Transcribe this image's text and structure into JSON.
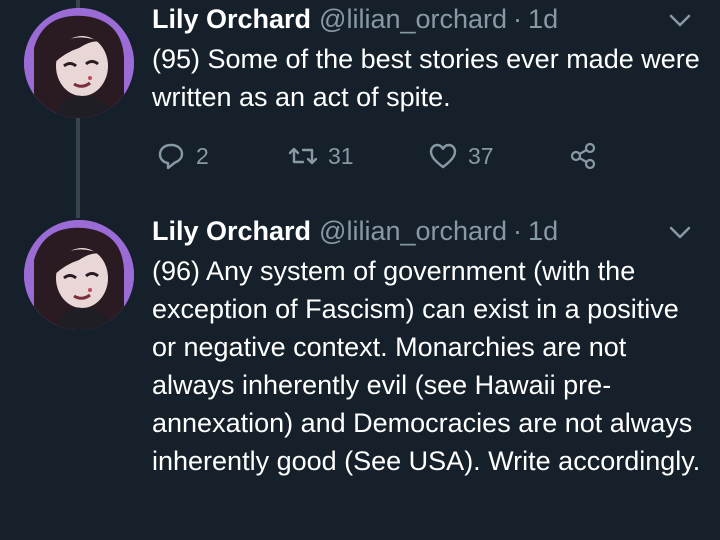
{
  "tweets": [
    {
      "name": "Lily Orchard",
      "handle": "@lilian_orchard",
      "separator": "·",
      "time": "1d",
      "text": "(95) Some of the best stories ever made were written as an act of spite.",
      "replies": "2",
      "retweets": "31",
      "likes": "37"
    },
    {
      "name": "Lily Orchard",
      "handle": "@lilian_orchard",
      "separator": "·",
      "time": "1d",
      "text": "(96) Any system of government (with the exception of Fascism) can exist in a positive or negative context. Monarchies are not always inherently evil (see Hawaii pre-annexation) and Democracies are not always inherently good (See USA). Write accordingly."
    }
  ],
  "colors": {
    "background": "#15202b",
    "secondary_text": "#8899a6",
    "thread_line": "#38444d",
    "avatar_purple": "#9b6bd6"
  },
  "icons": [
    "reply-icon",
    "retweet-icon",
    "like-icon",
    "share-icon",
    "chevron-down-icon"
  ]
}
